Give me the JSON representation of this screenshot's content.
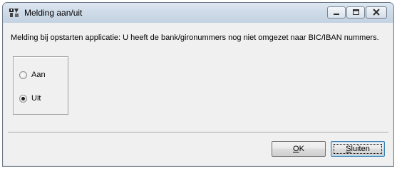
{
  "window": {
    "title": "Melding aan/uit",
    "app_icon": "application-icon"
  },
  "titlebar_buttons": {
    "minimize_icon": "minimize-icon",
    "maximize_icon": "maximize-icon",
    "close_icon": "close-icon"
  },
  "message": "Melding bij opstarten applicatie: U heeft de bank/gironummers nog niet omgezet naar BIC/IBAN nummers.",
  "options": [
    {
      "label": "Aan",
      "selected": false
    },
    {
      "label": "Uit",
      "selected": true
    }
  ],
  "buttons": {
    "ok": {
      "label": "OK",
      "mnemonic": "O",
      "rest": "K"
    },
    "close": {
      "label": "Sluiten",
      "mnemonic": "S",
      "rest": "luiten"
    }
  }
}
